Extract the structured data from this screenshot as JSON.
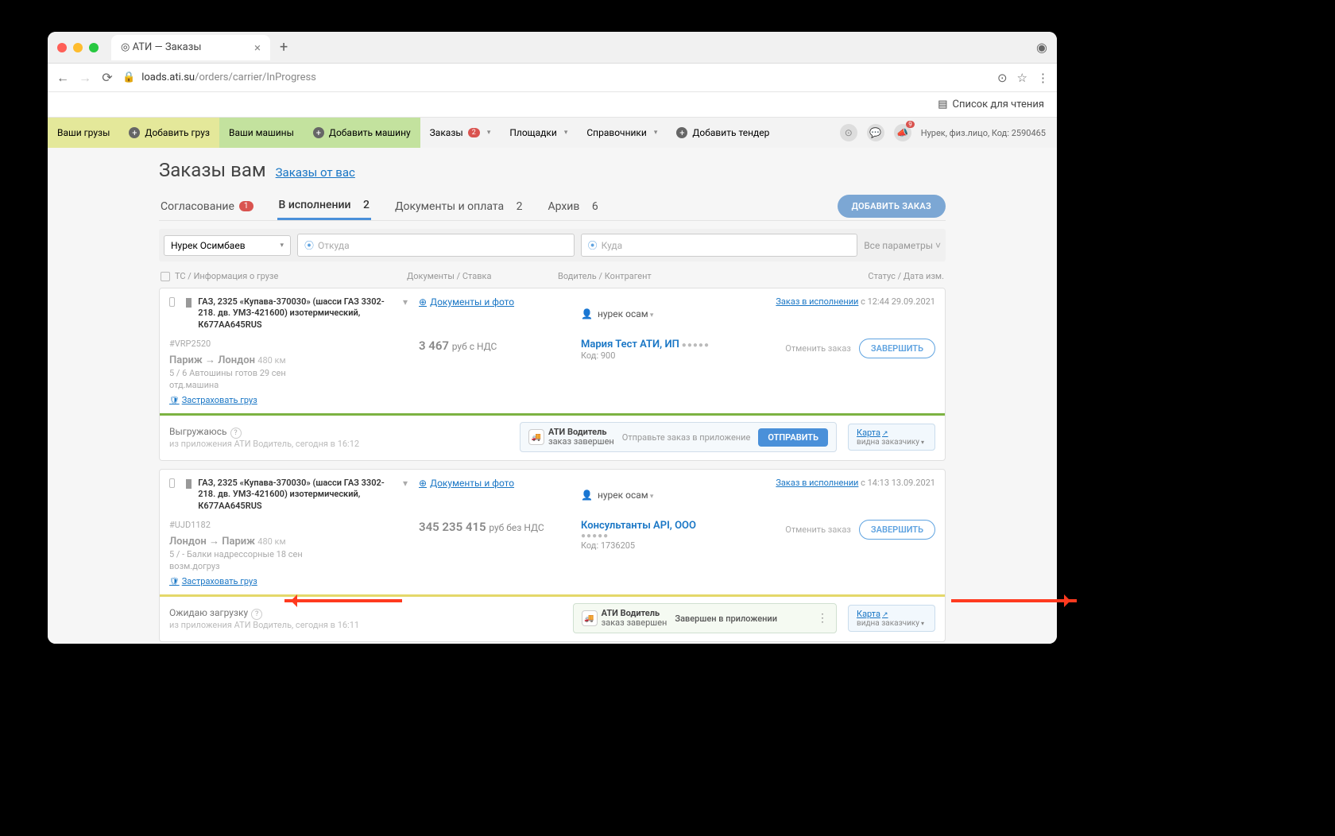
{
  "browser": {
    "tab_title": "АТИ — Заказы",
    "url_domain": "loads.ati.su",
    "url_path": "/orders/carrier/InProgress",
    "reading_list": "Список для чтения"
  },
  "topnav": {
    "your_cargo": "Ваши грузы",
    "add_cargo": "Добавить груз",
    "your_trucks": "Ваши машины",
    "add_truck": "Добавить машину",
    "orders": "Заказы",
    "orders_badge": "2",
    "platforms": "Площадки",
    "refs": "Справочники",
    "add_tender": "Добавить тендер",
    "notif_badge": "9",
    "user": "Нурек, физ.лицо,",
    "code": "Код: 2590465"
  },
  "page": {
    "title": "Заказы вам",
    "link": "Заказы от вас",
    "add_btn": "ДОБАВИТЬ ЗАКАЗ",
    "tabs": [
      {
        "label": "Согласование",
        "count": "1",
        "badge": true
      },
      {
        "label": "В исполнении",
        "count": "2",
        "active": true
      },
      {
        "label": "Документы и оплата",
        "count": "2"
      },
      {
        "label": "Архив",
        "count": "6"
      }
    ]
  },
  "filters": {
    "person": "Нурек Осимбаев",
    "from": "Откуда",
    "to": "Куда",
    "all": "Все параметры"
  },
  "headers": {
    "c1": "ТС / Информация о грузе",
    "c2": "Документы / Ставка",
    "c3": "Водитель / Контрагент",
    "c4": "Статус / Дата изм."
  },
  "cards": [
    {
      "vehicle": "ГАЗ, 2325 «Купава-370030» (шасси ГАЗ 3302-218. дв. УМЗ-421600) изотермический, К677АА645RUS",
      "docs": "Документы и фото",
      "driver": "нурек осам",
      "status_link": "Заказ в исполнении",
      "status_time": "с 12:44 29.09.2021",
      "id": "#VRP2520",
      "route_from": "Париж",
      "route_to": "Лондон",
      "dist": "480 км",
      "sub1": "5 / 6 Автошины готов 29 сен",
      "sub2": "отд.машина",
      "insure": "Застраховать груз",
      "price": "3 467",
      "price_sub": "руб с НДС",
      "agent": "Мария Тест АТИ, ИП",
      "agent_code": "Код: 900",
      "cancel": "Отменить заказ",
      "finish": "ЗАВЕРШИТЬ",
      "bot_status": "Выгружаюсь",
      "bot_sub": "из приложения АТИ Водитель,  сегодня в 16:12",
      "app_name": "АТИ Водитель",
      "app_status": "заказ завершен",
      "app_msg": "Отправьте заказ в приложение",
      "send": "ОТПРАВИТЬ",
      "map": "Карта",
      "map_sub": "видна заказчику"
    },
    {
      "vehicle": "ГАЗ, 2325 «Купава-370030» (шасси ГАЗ 3302-218. дв. УМЗ-421600) изотермический, К677АА645RUS",
      "docs": "Документы и фото",
      "driver": "нурек осам",
      "status_link": "Заказ в исполнении",
      "status_time": "с 14:13 13.09.2021",
      "id": "#UJD1182",
      "route_from": "Лондон",
      "route_to": "Париж",
      "dist": "480 км",
      "sub1": "5 / - Балки надрессорные 18 сен",
      "sub2": "возм.догруз",
      "insure": "Застраховать груз",
      "price": "345 235 415",
      "price_sub": "руб без НДС",
      "agent": "Консультанты API, ООО",
      "agent_code": "Код: 1736205",
      "cancel": "Отменить заказ",
      "finish": "ЗАВЕРШИТЬ",
      "bot_status": "Ожидаю загрузку",
      "bot_sub": "из приложения АТИ Водитель,  сегодня в 16:11",
      "app_name": "АТИ Водитель",
      "app_status": "заказ завершен",
      "app_msg": "Завершен в приложении",
      "map": "Карта",
      "map_sub": "видна заказчику"
    }
  ]
}
